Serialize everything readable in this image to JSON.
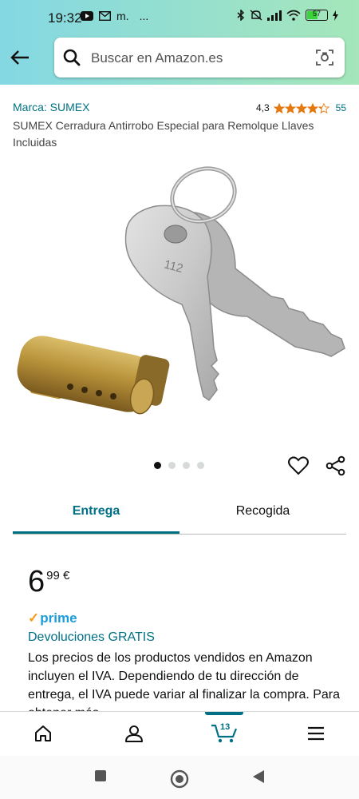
{
  "status_bar": {
    "time": "19:32",
    "left_icons": [
      "youtube-icon",
      "gmail-icon",
      "m.",
      "..."
    ],
    "right_icons": [
      "bluetooth-icon",
      "mute-icon",
      "signal-icon",
      "wifi-icon"
    ],
    "battery": "57",
    "battery_level": 0.57
  },
  "search": {
    "placeholder": "Buscar en Amazon.es",
    "back_icon": "arrow-left-icon",
    "search_icon": "search-icon",
    "camera_icon": "camera-icon"
  },
  "product": {
    "brand": "Marca: SUMEX",
    "rating_value": "4,3",
    "stars": 4.3,
    "rating_count": "55",
    "title": "SUMEX Cerradura Antirrobo Especial para Remolque Llaves Incluidas",
    "key_number": "112",
    "image_count": 4,
    "active_image": 0
  },
  "tabs": [
    {
      "label": "Entrega",
      "active": true
    },
    {
      "label": "Recogida",
      "active": false
    }
  ],
  "pricing": {
    "whole": "6",
    "fraction": "99 €",
    "prime_check": "✓",
    "prime": "prime",
    "returns": "Devoluciones GRATIS",
    "vat_text": "Los precios de los productos vendidos en Amazon incluyen el IVA. Dependiendo de tu dirección de entrega, el IVA puede variar al finalizar la compra. Para obtener más"
  },
  "bottom_nav": {
    "items": [
      "home-icon",
      "account-icon",
      "cart-icon",
      "menu-icon"
    ],
    "cart_count": "13"
  },
  "colors": {
    "link": "#007185",
    "star": "#e47911",
    "prime": "#1b9bd8",
    "header_gradient_start": "#84d8e3",
    "header_gradient_end": "#a5e6ba"
  }
}
